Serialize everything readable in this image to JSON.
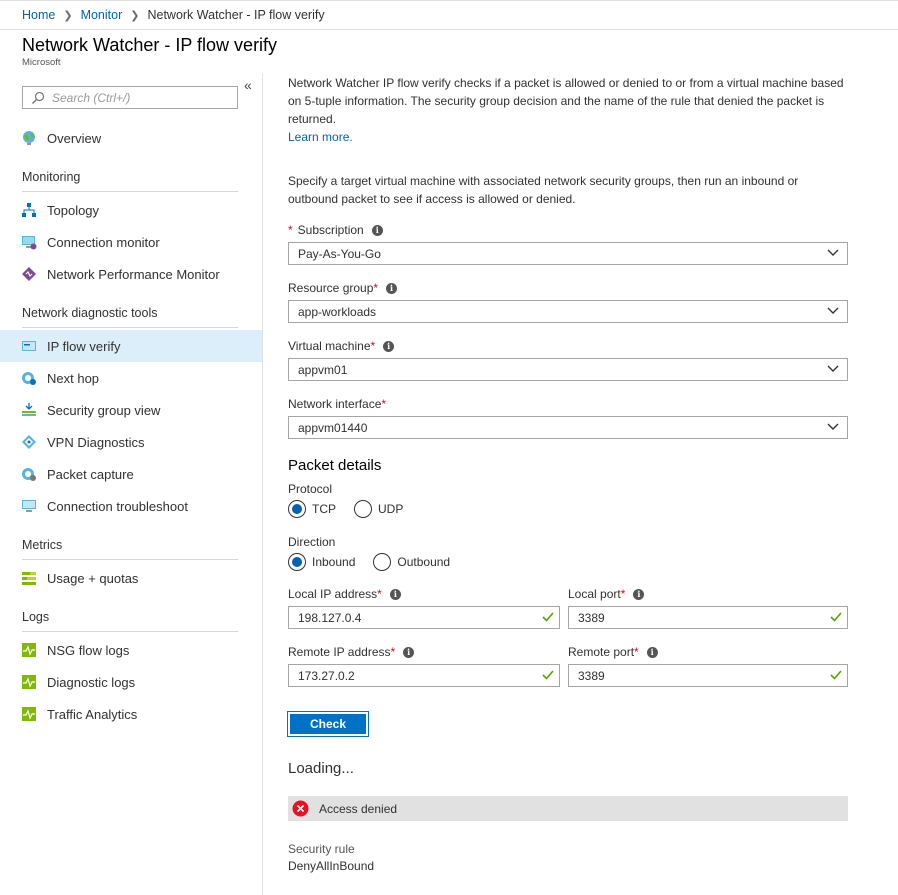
{
  "breadcrumb": {
    "items": [
      "Home",
      "Monitor"
    ],
    "current": "Network Watcher - IP flow verify"
  },
  "page": {
    "title": "Network Watcher - IP flow verify",
    "subtitle": "Microsoft"
  },
  "sidebar": {
    "collapse_glyph": "«",
    "search_placeholder": "Search (Ctrl+/)",
    "overview": "Overview",
    "sections": {
      "monitoring": "Monitoring",
      "diagnostic": "Network diagnostic tools",
      "metrics": "Metrics",
      "logs": "Logs"
    },
    "monitoring_items": [
      "Topology",
      "Connection monitor",
      "Network Performance Monitor"
    ],
    "diagnostic_items": [
      "IP flow verify",
      "Next hop",
      "Security group view",
      "VPN Diagnostics",
      "Packet capture",
      "Connection troubleshoot"
    ],
    "metrics_items": [
      "Usage + quotas"
    ],
    "logs_items": [
      "NSG flow logs",
      "Diagnostic logs",
      "Traffic Analytics"
    ],
    "active_item": "IP flow verify"
  },
  "main": {
    "intro": "Network Watcher IP flow verify checks if a packet is allowed or denied to or from a virtual machine based on 5-tuple information. The security group decision and the name of the rule that denied the packet is returned.",
    "learn_more": "Learn more.",
    "instructions": "Specify a target virtual machine with associated network security groups, then run an inbound or outbound packet to see if access is allowed or denied.",
    "subscription": {
      "label": "Subscription",
      "value": "Pay-As-You-Go"
    },
    "resource_group": {
      "label": "Resource group",
      "value": "app-workloads"
    },
    "virtual_machine": {
      "label": "Virtual machine",
      "value": "appvm01"
    },
    "network_interface": {
      "label": "Network interface",
      "value": "appvm01440"
    },
    "packet_details": "Packet details",
    "protocol": {
      "label": "Protocol",
      "options": [
        "TCP",
        "UDP"
      ],
      "selected": "TCP"
    },
    "direction": {
      "label": "Direction",
      "options": [
        "Inbound",
        "Outbound"
      ],
      "selected": "Inbound"
    },
    "local_ip": {
      "label": "Local IP address",
      "value": "198.127.0.4"
    },
    "local_port": {
      "label": "Local port",
      "value": "3389"
    },
    "remote_ip": {
      "label": "Remote IP address",
      "value": "173.27.0.2"
    },
    "remote_port": {
      "label": "Remote port",
      "value": "3389"
    },
    "check_button": "Check",
    "loading": "Loading...",
    "result": "Access denied",
    "security_rule_label": "Security rule",
    "security_rule_value": "DenyAllInBound"
  },
  "colors": {
    "accent": "#0072c6",
    "link": "#0062b1",
    "active_nav": "#dceefa",
    "required": "#c50f1f",
    "valid": "#57a300",
    "error": "#e81123"
  }
}
